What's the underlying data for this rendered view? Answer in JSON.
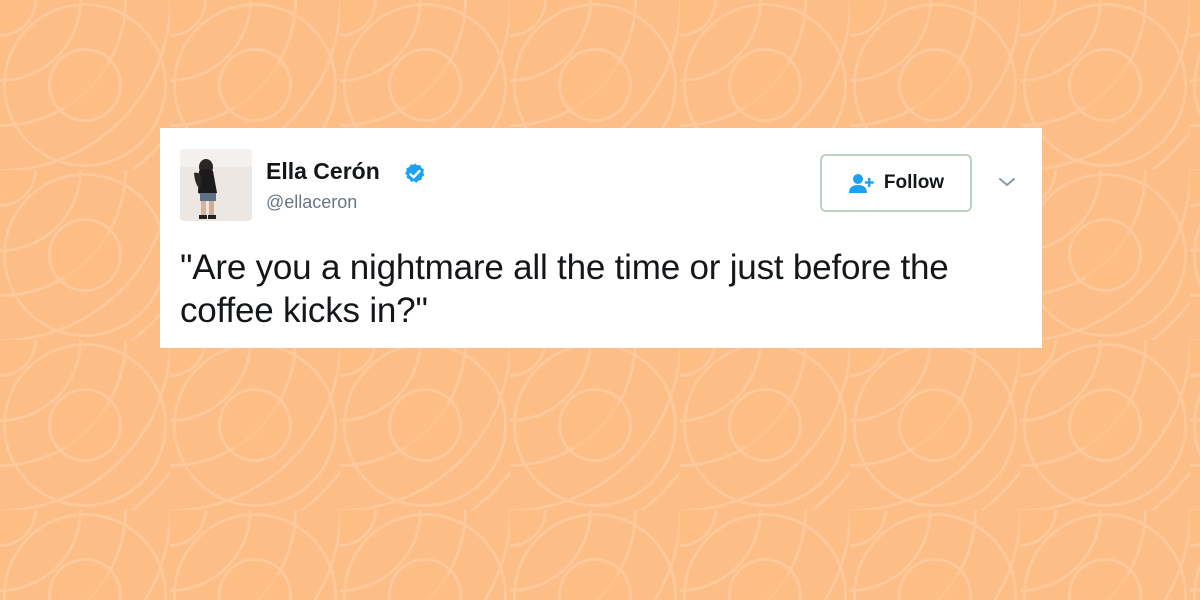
{
  "colors": {
    "background": "#fdbd86",
    "card": "#ffffff",
    "text": "#14171a",
    "handle": "#657786",
    "verified": "#1da1f2",
    "follow_border": "#b9d3c0"
  },
  "tweet": {
    "author": {
      "name": "Ella Cerón",
      "handle": "@ellaceron",
      "verified_icon": "verified-badge-icon",
      "avatar_icon": "profile-photo"
    },
    "follow_button": {
      "label": "Follow",
      "icon": "add-user-icon"
    },
    "menu_icon": "chevron-down-icon",
    "text": "\"Are you a nightmare all the time or just before the coffee kicks in?\""
  }
}
